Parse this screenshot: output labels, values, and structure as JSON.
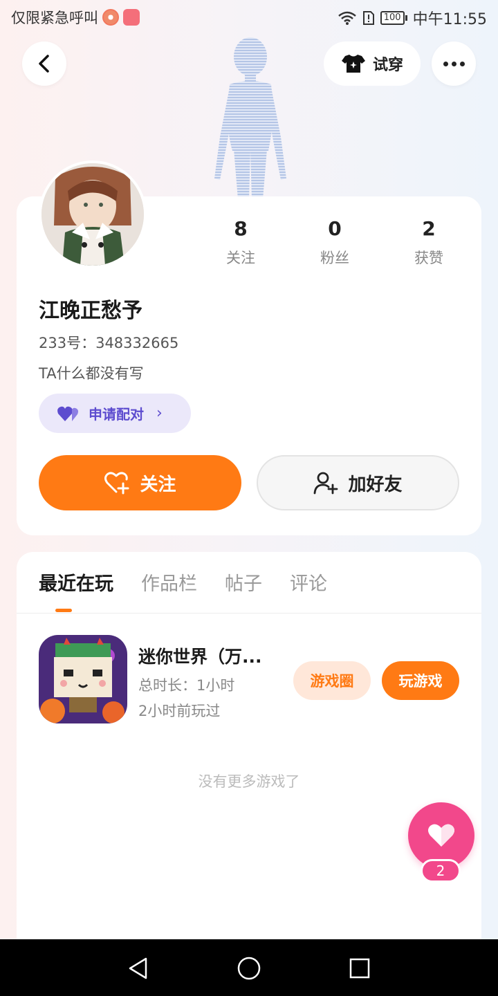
{
  "status_bar": {
    "carrier_text": "仅限紧急呼叫",
    "battery": "100",
    "time": "中午11:55"
  },
  "header": {
    "tryon_label": "试穿"
  },
  "profile": {
    "stats": [
      {
        "value": "8",
        "label": "关注"
      },
      {
        "value": "0",
        "label": "粉丝"
      },
      {
        "value": "2",
        "label": "获赞"
      }
    ],
    "username": "江晚正愁予",
    "user_id": "233号：348332665",
    "bio": "TA什么都没有写",
    "pair_label": "申请配对",
    "follow_label": "关注",
    "add_friend_label": "加好友"
  },
  "tabs": [
    {
      "label": "最近在玩",
      "active": true
    },
    {
      "label": "作品栏",
      "active": false
    },
    {
      "label": "帖子",
      "active": false
    },
    {
      "label": "评论",
      "active": false
    }
  ],
  "games": [
    {
      "title": "迷你世界（万...",
      "playtime": "总时长：1小时",
      "last_played": "2小时前玩过",
      "circle_label": "游戏圈",
      "play_label": "玩游戏"
    }
  ],
  "no_more_text": "没有更多游戏了",
  "like_fab": {
    "count": "2"
  },
  "colors": {
    "accent": "#ff7a14",
    "pair": "#5d4ccf",
    "like": "#f2488b"
  }
}
